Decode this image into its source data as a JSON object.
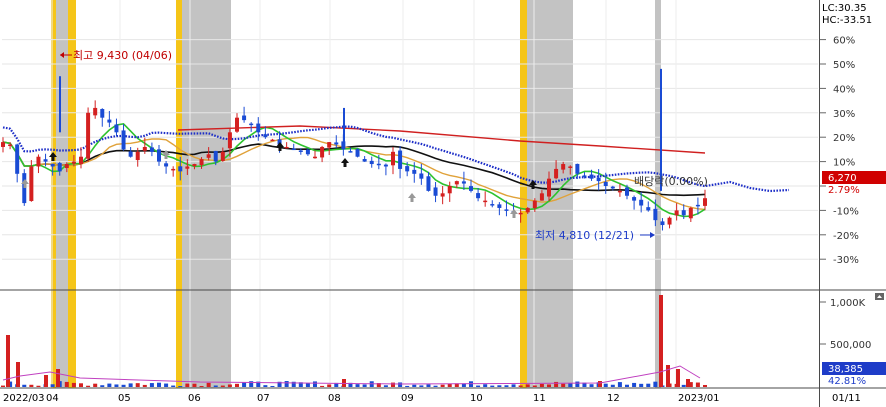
{
  "header": {
    "lc_label": "LC:30.35",
    "hc_label": "HC:-33.51",
    "lc_color": "#d00000",
    "hc_color": "#1e3cc8"
  },
  "chart_data": {
    "type": "candlestick",
    "title": "",
    "price_axis": {
      "ticks": [
        "60%",
        "50%",
        "40%",
        "30%",
        "20%",
        "10%",
        "0%",
        "-10%",
        "-20%",
        "-30%"
      ],
      "range_pct": [
        -38,
        65
      ]
    },
    "volume_axis": {
      "ticks": [
        "1,000K",
        "500,000"
      ]
    },
    "x_axis": {
      "labels": [
        "2022/03",
        "04",
        "05",
        "06",
        "07",
        "08",
        "09",
        "10",
        "11",
        "12",
        "2023/01"
      ],
      "right_label": "01/11"
    },
    "current_price": {
      "value": "6,270",
      "change": "2.79%",
      "box_color": "#d00000"
    },
    "current_volume": {
      "value": "38,385",
      "change": "42.81%",
      "box_color": "#1e3cc8"
    },
    "annotations": {
      "high": "최고 9,430 (04/06)",
      "low": "최저 4,810 (12/21)",
      "dividend": "배당락(0.00%)"
    },
    "highlights": {
      "yellow_bands": [
        "2022/03 late",
        "2022/04 early",
        "2022/05 late",
        "2022/10 late"
      ],
      "gray_bands": [
        "2022/04 early",
        "2022/05 late - 06 early",
        "2022/10 late - 11 mid",
        "2022/12 late"
      ]
    },
    "series": [
      {
        "name": "price",
        "color_up": "#d42020",
        "color_down": "#1a4bd4",
        "values_pct": [
          18,
          17,
          5,
          -7,
          8,
          12,
          10,
          8,
          6,
          9,
          10,
          12,
          30,
          32,
          28,
          26,
          22,
          15,
          12,
          14,
          16,
          14,
          10,
          8,
          7,
          6,
          8,
          9,
          11,
          13,
          10,
          14,
          22,
          28,
          27,
          25,
          22,
          20,
          19,
          17,
          16,
          15,
          14,
          13,
          12,
          16,
          18,
          17,
          15,
          14,
          12,
          10,
          9,
          9,
          8,
          14,
          7,
          6,
          5,
          3,
          -2,
          -4,
          -3,
          0,
          2,
          1,
          -2,
          -5,
          -6,
          -8,
          -9,
          -10,
          -11,
          -11,
          -9,
          -6,
          -3,
          3,
          7,
          9,
          8,
          5,
          4,
          3,
          2,
          0,
          -1,
          -2,
          -4,
          -6,
          -8,
          -10,
          -14,
          -16,
          -13,
          -10,
          -12,
          -9,
          -8,
          -5
        ]
      },
      {
        "name": "ma-green",
        "color": "#2ec22e"
      },
      {
        "name": "ma-orange",
        "color": "#e0a23a"
      },
      {
        "name": "ma-black",
        "color": "#111111"
      },
      {
        "name": "ma-red",
        "color": "#d02020"
      },
      {
        "name": "ma-blue-dotted",
        "color": "#1e2fc8"
      }
    ]
  }
}
